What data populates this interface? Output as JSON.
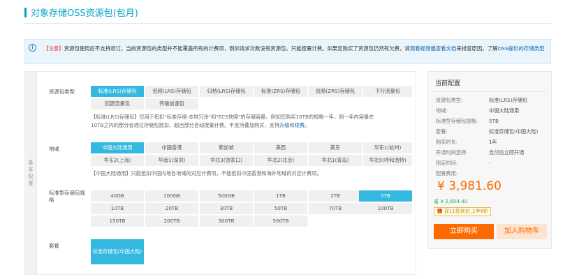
{
  "header": {
    "title": "对象存储OSS资源包(包月)"
  },
  "notice": {
    "tag": "【注意】",
    "text1": "资源包使用后不支持退订。当前资源包的类型并不能覆盖所有的计费项，例如请求次数没有资源包，只能按量计费。如果您购买了资源包仍然有欠费，请",
    "link1": "观看视频",
    "sep": "或",
    "link2": "查看文档",
    "text2": "来排查原因。了解",
    "link3": "OSS提供的存储类型"
  },
  "config": {
    "side_label": [
      "基",
      "本",
      "配",
      "置"
    ],
    "package_type": {
      "label": "资源包类型",
      "options": [
        "标准(LRS)存储包",
        "低频(LRS)存储包",
        "归档(LRS)存储包",
        "标准(ZRS)存储包",
        "低频(ZRS)存储包",
        "下行流量包",
        "回源流量包",
        "传输加速包"
      ],
      "selected": 0,
      "desc_line1": "【标准(LRS)存储包】仅用于抵扣\"标准存储-本地冗余\"和\"ECS快照\"的存储容量。例如您购买10TB的规格一年，则一年内容量在",
      "desc_line2a": "10TB之内的部分会通过存储包抵扣，超出部分自动按量计费。不支持叠加购买，支持",
      "desc_link1": "升级",
      "desc_and": "和",
      "desc_link2": "续费",
      "desc_end": "。"
    },
    "region": {
      "label": "地域",
      "options": [
        "中国大陆通用",
        "中国香港",
        "新加坡",
        "美西",
        "美东",
        "华东1(杭州)",
        "华东2(上海)",
        "华南1(深圳)",
        "华北3(张家口)",
        "华北2(北京)",
        "华北1(青岛)",
        "华北5(呼和浩特)"
      ],
      "selected": 0,
      "desc": "【中国大陆通用】只能抵扣中国内地各地域的对应计费项，不能抵扣中国香港和海外地域的对应计费项。"
    },
    "capacity": {
      "label_line1": "标准型存储包规",
      "label_line2": "格",
      "options": [
        "40GB",
        "100GB",
        "500GB",
        "1TB",
        "2TB",
        "5TB",
        "10TB",
        "20TB",
        "30TB",
        "50TB",
        "70TB",
        "100TB",
        "150TB",
        "200TB",
        "300TB",
        "500TB"
      ],
      "selected": 5
    },
    "package": {
      "label": "套餐",
      "option": "标准存储包(中国大陆)"
    }
  },
  "summary": {
    "title": "当前配置",
    "rows": [
      {
        "k": "资源包类型:",
        "v": "标准(LRS)存储包"
      },
      {
        "k": "地域:",
        "v": "中国大陆通用"
      },
      {
        "k": "标准型存储包规格:",
        "v": "5TB"
      },
      {
        "k": "套餐:",
        "v": "标准存储包(中国大陆)"
      },
      {
        "k": "购买时长:",
        "v": "1年"
      },
      {
        "k": "开通时间选择:",
        "v": "支付后立即开通"
      },
      {
        "k": "指定时间:",
        "v": "-"
      }
    ],
    "fee_label": "配置费用:",
    "price": "¥ 3,981.60",
    "save": "省 ¥ 2,654.40",
    "promo": "双11狂欢价_1年6折",
    "buy_label": "立即购买",
    "cart_label": "加入购物车"
  }
}
